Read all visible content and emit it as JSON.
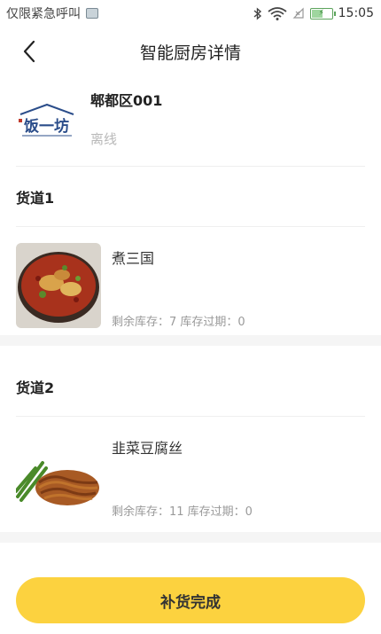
{
  "status_bar": {
    "carrier": "仅限紧急呼叫",
    "time": "15:05",
    "battery_level": 0.52,
    "icons": [
      "notification-icon",
      "bluetooth-icon",
      "wifi-icon",
      "no-signal-icon",
      "battery-icon"
    ]
  },
  "nav": {
    "title": "智能厨房详情",
    "back_icon": "chevron-left-icon"
  },
  "device": {
    "name": "郫都区001",
    "status": "离线",
    "logo_text": "饭一坊"
  },
  "lanes": [
    {
      "title": "货道1",
      "dish": "煮三国",
      "stock_text": "剩余库存：7  库存过期：0"
    },
    {
      "title": "货道2",
      "dish": "韭菜豆腐丝",
      "stock_text": "剩余库存：11  库存过期：0"
    }
  ],
  "actions": {
    "submit_label": "补货完成"
  },
  "colors": {
    "accent": "#fcd23f",
    "muted_text": "#9a9a9a",
    "status_offline": "#b9b9b9"
  }
}
